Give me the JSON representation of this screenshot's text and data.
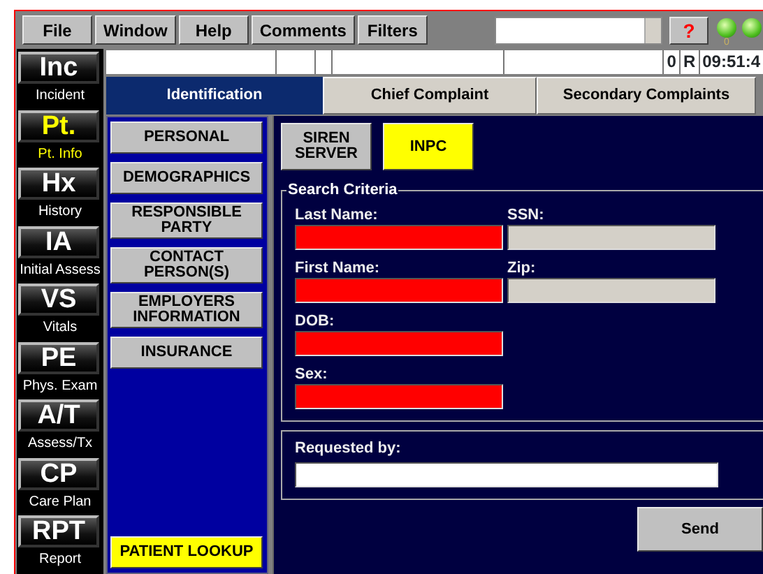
{
  "menu": [
    {
      "label": "File"
    },
    {
      "label": "Window"
    },
    {
      "label": "Help"
    },
    {
      "label": "Comments"
    },
    {
      "label": "Filters"
    }
  ],
  "help_button": "?",
  "indicator_label": "0",
  "status": {
    "count": "0",
    "mode": "R",
    "time": "09:51:4"
  },
  "nav": [
    {
      "abbr": "Inc",
      "label": "Incident",
      "selected": false
    },
    {
      "abbr": "Pt.",
      "label": "Pt. Info",
      "selected": true
    },
    {
      "abbr": "Hx",
      "label": "History",
      "selected": false
    },
    {
      "abbr": "IA",
      "label": "Initial Assess",
      "selected": false
    },
    {
      "abbr": "VS",
      "label": "Vitals",
      "selected": false
    },
    {
      "abbr": "PE",
      "label": "Phys. Exam",
      "selected": false
    },
    {
      "abbr": "A/T",
      "label": "Assess/Tx",
      "selected": false
    },
    {
      "abbr": "CP",
      "label": "Care Plan",
      "selected": false
    },
    {
      "abbr": "RPT",
      "label": "Report",
      "selected": false
    }
  ],
  "tabs": [
    {
      "label": "Identification",
      "selected": true
    },
    {
      "label": "Chief Complaint",
      "selected": false
    },
    {
      "label": "Secondary Complaints",
      "selected": false
    }
  ],
  "sections": [
    {
      "label": "PERSONAL",
      "selected": false
    },
    {
      "label": "DEMOGRAPHICS",
      "selected": false
    },
    {
      "label": "RESPONSIBLE PARTY",
      "selected": false
    },
    {
      "label": "CONTACT PERSON(S)",
      "selected": false
    },
    {
      "label": "EMPLOYERS INFORMATION",
      "selected": false
    },
    {
      "label": "INSURANCE",
      "selected": false
    }
  ],
  "lookup": {
    "label": "PATIENT LOOKUP",
    "selected": true
  },
  "sources": [
    {
      "label": "SIREN SERVER",
      "selected": false
    },
    {
      "label": "INPC",
      "selected": true
    }
  ],
  "search": {
    "title": "Search Criteria",
    "rows": [
      [
        {
          "label": "Last Name:",
          "kind": "required"
        },
        {
          "label": "SSN:",
          "kind": "disabled"
        }
      ],
      [
        {
          "label": "First Name:",
          "kind": "required"
        },
        {
          "label": "Zip:",
          "kind": "disabled"
        }
      ],
      [
        {
          "label": "DOB:",
          "kind": "required"
        }
      ],
      [
        {
          "label": "Sex:",
          "kind": "required"
        }
      ]
    ]
  },
  "requested": {
    "label": "Requested by:"
  },
  "send": "Send"
}
